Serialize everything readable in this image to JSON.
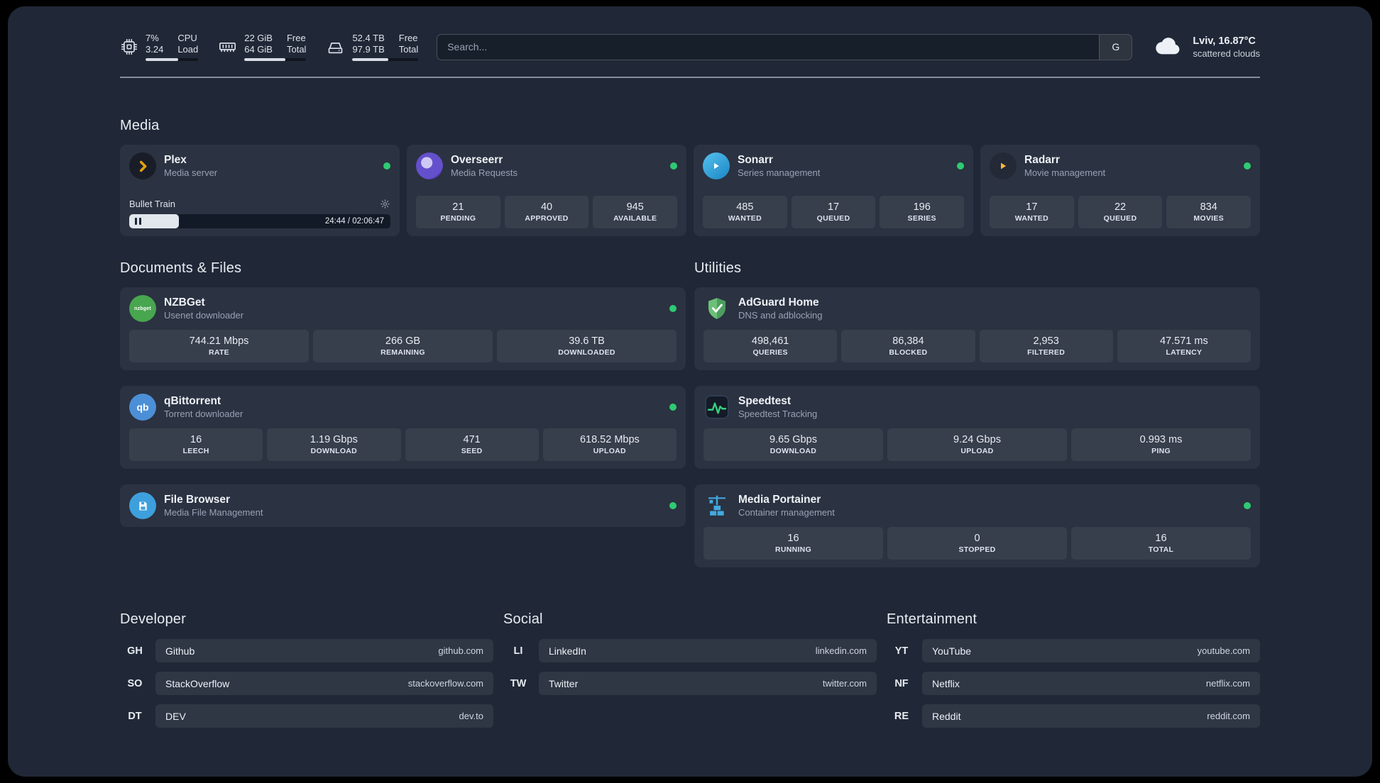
{
  "colors": {
    "panel_bg": "#202837",
    "status_green": "#2ecb72",
    "plex_amber": "#e5a00d",
    "sonarr_blue": "#1b84c4",
    "radarr_orange": "#ffb53c",
    "overseerr_purple": "#5a48c4",
    "nzbget_green": "#48a64f",
    "qbittorrent_blue": "#4c8fd6",
    "filebrowser_blue": "#3da0dd",
    "adguard_green": "#5fb369",
    "speedtest_green": "#35d07f",
    "portainer_blue": "#42a9e0"
  },
  "topbar": {
    "cpu": {
      "value": "7%",
      "value2": "3.24",
      "label1": "CPU",
      "label2": "Load",
      "progress": 62
    },
    "memory": {
      "value": "22 GiB",
      "value2": "64 GiB",
      "label1": "Free",
      "label2": "Total",
      "progress": 66
    },
    "disk": {
      "value": "52.4 TB",
      "value2": "97.9 TB",
      "label1": "Free",
      "label2": "Total",
      "progress": 54
    },
    "search": {
      "placeholder": "Search...",
      "button_label": "G"
    },
    "weather": {
      "location": "Lviv, 16.87°C",
      "condition": "scattered clouds"
    }
  },
  "sections": {
    "media": {
      "title": "Media"
    },
    "documents": {
      "title": "Documents & Files"
    },
    "utilities": {
      "title": "Utilities"
    }
  },
  "apps": {
    "plex": {
      "name": "Plex",
      "subtitle": "Media server",
      "now_playing": "Bullet Train",
      "progress_time": "24:44 / 02:06:47",
      "progress_pct": 19
    },
    "overseerr": {
      "name": "Overseerr",
      "subtitle": "Media Requests",
      "stats": [
        {
          "value": "21",
          "label": "PENDING"
        },
        {
          "value": "40",
          "label": "APPROVED"
        },
        {
          "value": "945",
          "label": "AVAILABLE"
        }
      ]
    },
    "sonarr": {
      "name": "Sonarr",
      "subtitle": "Series management",
      "stats": [
        {
          "value": "485",
          "label": "WANTED"
        },
        {
          "value": "17",
          "label": "QUEUED"
        },
        {
          "value": "196",
          "label": "SERIES"
        }
      ]
    },
    "radarr": {
      "name": "Radarr",
      "subtitle": "Movie management",
      "stats": [
        {
          "value": "17",
          "label": "WANTED"
        },
        {
          "value": "22",
          "label": "QUEUED"
        },
        {
          "value": "834",
          "label": "MOVIES"
        }
      ]
    },
    "nzbget": {
      "name": "NZBGet",
      "subtitle": "Usenet downloader",
      "icon_text": "nzbget",
      "stats": [
        {
          "value": "744.21 Mbps",
          "label": "RATE"
        },
        {
          "value": "266 GB",
          "label": "REMAINING"
        },
        {
          "value": "39.6 TB",
          "label": "DOWNLOADED"
        }
      ]
    },
    "qbittorrent": {
      "name": "qBittorrent",
      "subtitle": "Torrent downloader",
      "icon_text": "qb",
      "stats": [
        {
          "value": "16",
          "label": "LEECH"
        },
        {
          "value": "1.19 Gbps",
          "label": "DOWNLOAD"
        },
        {
          "value": "471",
          "label": "SEED"
        },
        {
          "value": "618.52 Mbps",
          "label": "UPLOAD"
        }
      ]
    },
    "filebrowser": {
      "name": "File Browser",
      "subtitle": "Media File Management"
    },
    "adguard": {
      "name": "AdGuard Home",
      "subtitle": "DNS and adblocking",
      "stats": [
        {
          "value": "498,461",
          "label": "QUERIES"
        },
        {
          "value": "86,384",
          "label": "BLOCKED"
        },
        {
          "value": "2,953",
          "label": "FILTERED"
        },
        {
          "value": "47.571 ms",
          "label": "LATENCY"
        }
      ]
    },
    "speedtest": {
      "name": "Speedtest",
      "subtitle": "Speedtest Tracking",
      "stats": [
        {
          "value": "9.65 Gbps",
          "label": "DOWNLOAD"
        },
        {
          "value": "9.24 Gbps",
          "label": "UPLOAD"
        },
        {
          "value": "0.993 ms",
          "label": "PING"
        }
      ]
    },
    "portainer": {
      "name": "Media Portainer",
      "subtitle": "Container management",
      "stats": [
        {
          "value": "16",
          "label": "RUNNING"
        },
        {
          "value": "0",
          "label": "STOPPED"
        },
        {
          "value": "16",
          "label": "TOTAL"
        }
      ]
    }
  },
  "bookmarks": [
    {
      "title": "Developer",
      "items": [
        {
          "abbr": "GH",
          "name": "Github",
          "domain": "github.com"
        },
        {
          "abbr": "SO",
          "name": "StackOverflow",
          "domain": "stackoverflow.com"
        },
        {
          "abbr": "DT",
          "name": "DEV",
          "domain": "dev.to"
        }
      ]
    },
    {
      "title": "Social",
      "items": [
        {
          "abbr": "LI",
          "name": "LinkedIn",
          "domain": "linkedin.com"
        },
        {
          "abbr": "TW",
          "name": "Twitter",
          "domain": "twitter.com"
        }
      ]
    },
    {
      "title": "Entertainment",
      "items": [
        {
          "abbr": "YT",
          "name": "YouTube",
          "domain": "youtube.com"
        },
        {
          "abbr": "NF",
          "name": "Netflix",
          "domain": "netflix.com"
        },
        {
          "abbr": "RE",
          "name": "Reddit",
          "domain": "reddit.com"
        }
      ]
    }
  ]
}
